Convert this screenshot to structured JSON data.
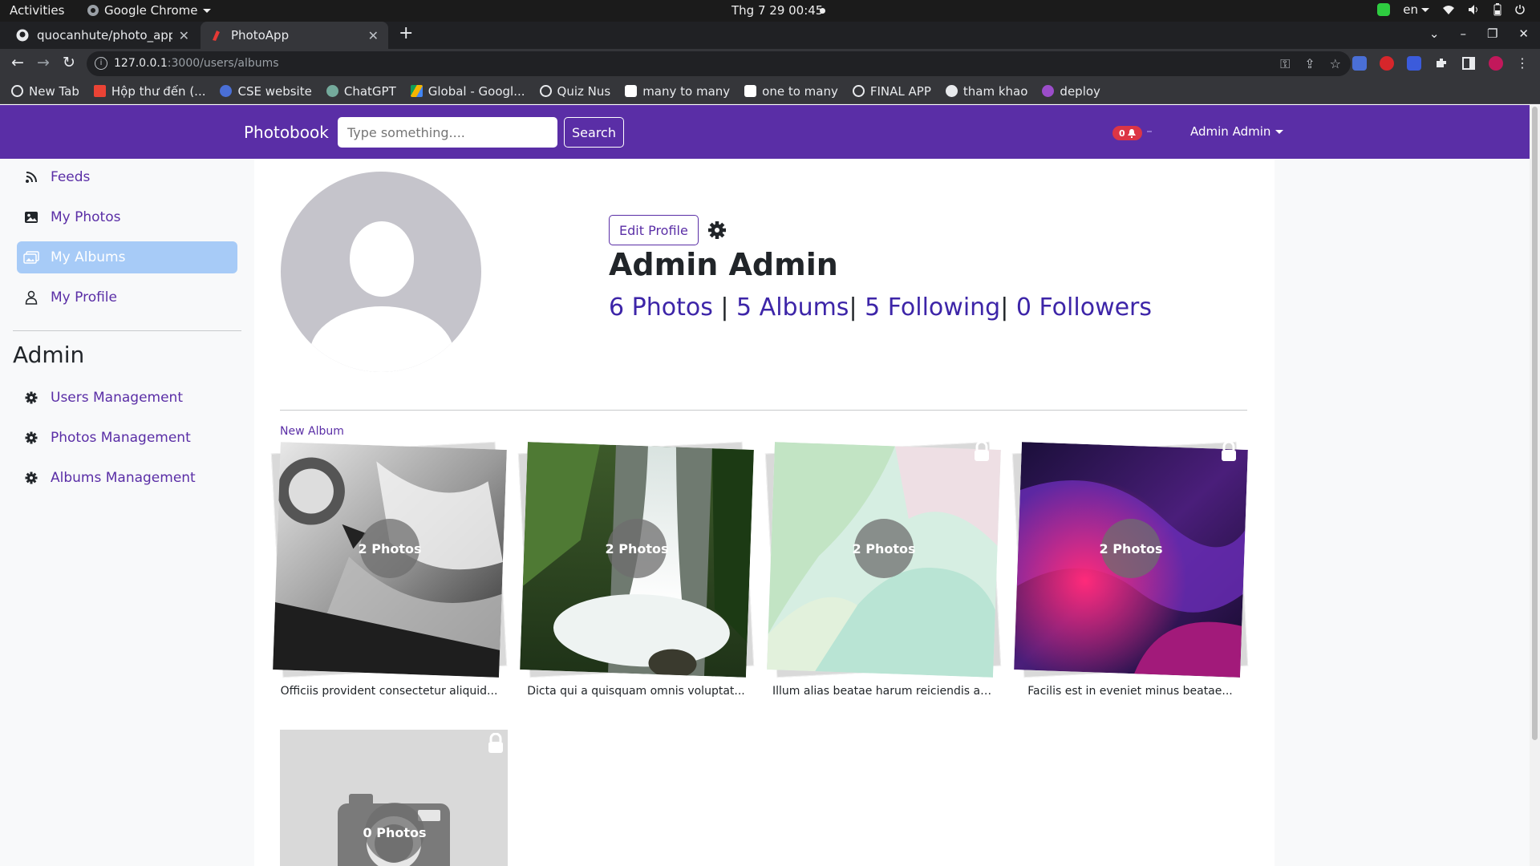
{
  "os": {
    "activities": "Activities",
    "app_name": "Google Chrome",
    "clock": "Thg 7 29  00:45",
    "lang": "en"
  },
  "browser": {
    "tabs": [
      {
        "title": "quocanhute/photo_app",
        "icon": "github-icon"
      },
      {
        "title": "PhotoApp",
        "icon": "photoapp-icon",
        "active": true
      }
    ],
    "url_host": "127.0.0.1",
    "url_path": ":3000/users/albums",
    "bookmarks": [
      {
        "label": "New Tab",
        "icon": "globe-icon",
        "color": "#e8eaed"
      },
      {
        "label": "Hộp thư đến (...",
        "icon": "gmail-icon",
        "color": "#ea4335"
      },
      {
        "label": "CSE website",
        "icon": "cse-icon",
        "color": "#4a6fd6"
      },
      {
        "label": "ChatGPT",
        "icon": "chatgpt-icon",
        "color": "#74aa9c"
      },
      {
        "label": "Global - Googl...",
        "icon": "drive-icon",
        "color": "#f4b400"
      },
      {
        "label": "Quiz Nus",
        "icon": "globe-icon",
        "color": "#e8eaed"
      },
      {
        "label": "many to many",
        "icon": "medium-icon",
        "color": "#ffffff"
      },
      {
        "label": "one to many",
        "icon": "medium-icon",
        "color": "#ffffff"
      },
      {
        "label": "FINAL APP",
        "icon": "globe-icon",
        "color": "#e8eaed"
      },
      {
        "label": "tham khao",
        "icon": "github-icon",
        "color": "#e8eaed"
      },
      {
        "label": "deploy",
        "icon": "heroku-icon",
        "color": "#9b4dca"
      }
    ]
  },
  "navbar": {
    "brand": "Photobook",
    "search_placeholder": "Type something....",
    "search_button": "Search",
    "notification_count": "0",
    "user_name": "Admin Admin"
  },
  "sidebar": {
    "items": [
      {
        "label": "Feeds",
        "icon": "rss-icon"
      },
      {
        "label": "My Photos",
        "icon": "image-icon"
      },
      {
        "label": "My Albums",
        "icon": "images-icon",
        "active": true
      },
      {
        "label": "My Profile",
        "icon": "user-icon"
      }
    ],
    "admin_heading": "Admin",
    "admin_items": [
      {
        "label": "Users Management",
        "icon": "gear-icon"
      },
      {
        "label": "Photos Management",
        "icon": "gear-icon"
      },
      {
        "label": "Albums Management",
        "icon": "gear-icon"
      }
    ]
  },
  "profile": {
    "edit_button": "Edit Profile",
    "name": "Admin Admin",
    "photos": "6 Photos",
    "albums": "5 Albums",
    "following": "5 Following",
    "followers": "0 Followers"
  },
  "albums": {
    "new_album_link": "New Album",
    "items": [
      {
        "count": "2 Photos",
        "caption": "Officiis provident consectetur aliquid...",
        "theme": "car-photo",
        "private": false
      },
      {
        "count": "2 Photos",
        "caption": "Dicta qui a quisquam omnis voluptat...",
        "theme": "waterfall-photo",
        "private": false
      },
      {
        "count": "2 Photos",
        "caption": "Illum alias beatae harum reiciendis au...",
        "theme": "pastel-abstract",
        "private": true
      },
      {
        "count": "2 Photos",
        "caption": "Facilis est in eveniet minus beatae...",
        "theme": "neon-abstract",
        "private": true
      },
      {
        "count": "0 Photos",
        "caption": "",
        "theme": "placeholder-camera",
        "private": true
      }
    ]
  },
  "colors": {
    "brand": "#5a2ea6",
    "link": "#3d25a8",
    "active_sidebar": "#a7cbf7",
    "badge": "#dc3545"
  }
}
